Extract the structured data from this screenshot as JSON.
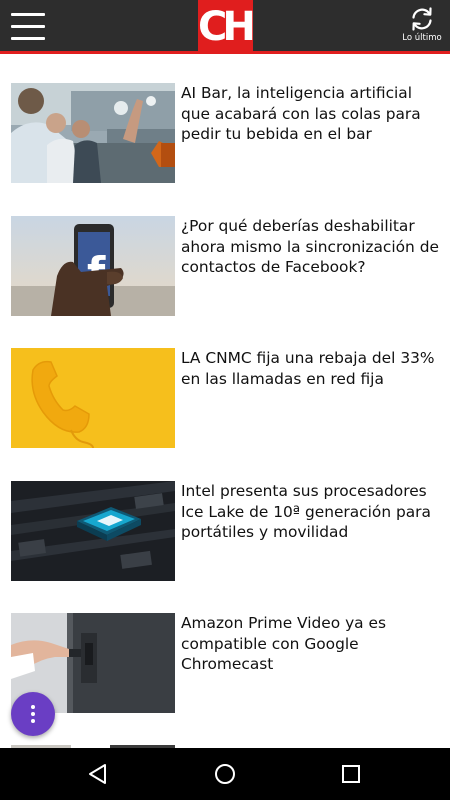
{
  "header": {
    "logo_text": "CH",
    "refresh_label": "Lo último",
    "colors": {
      "background": "#2d2d2d",
      "accent": "#e01e1e"
    },
    "icons": {
      "menu": "hamburger-menu-icon",
      "refresh": "refresh-icon"
    }
  },
  "articles": [
    {
      "title": "AI Bar, la inteligencia artificial que acabará con las colas para pedir tu bebida en el bar",
      "image": "bar-customers-photo"
    },
    {
      "title": "¿Por qué deberías deshabilitar ahora mismo la sincronización de contactos de Facebook?",
      "image": "phone-facebook-logo-photo"
    },
    {
      "title": "LA CNMC fija una rebaja del 33% en las llamadas en red fija",
      "image": "yellow-telephone-handset-photo"
    },
    {
      "title": "Intel presenta sus procesadores Ice Lake de 10ª generación para portátiles y movilidad",
      "image": "processor-chip-circuit-photo"
    },
    {
      "title": "Amazon Prime Video ya es compatible con Google Chromecast",
      "image": "hand-plugging-chromecast-photo"
    }
  ],
  "fab": {
    "icon": "more-vert-icon",
    "color": "#6a3ec4"
  },
  "navbar": {
    "icons": [
      "back-icon",
      "home-icon",
      "recents-icon"
    ]
  }
}
